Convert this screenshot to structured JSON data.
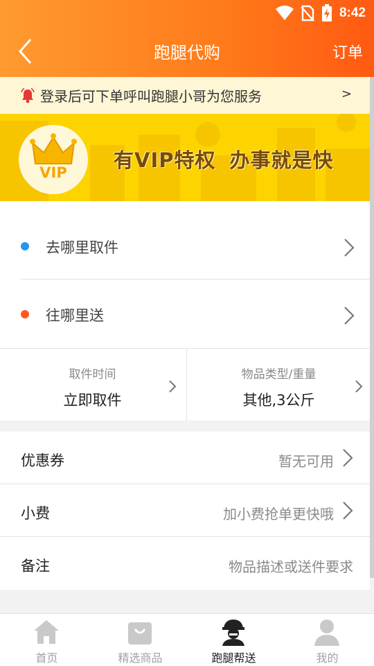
{
  "status_bar": {
    "time": "8:42",
    "icons": [
      "wifi-icon",
      "no-sim-icon",
      "battery-charging-icon"
    ]
  },
  "header": {
    "back_icon": "back-chevron-icon",
    "title": "跑腿代购",
    "orders_label": "订单"
  },
  "notice": {
    "icon": "bell-icon",
    "text": "登录后可下单呼叫跑腿小哥为您服务",
    "arrow": ">"
  },
  "banner": {
    "badge_icon": "crown-icon",
    "badge_text": "VIP",
    "slogan_1": "有VIP特权",
    "slogan_2": "办事就是快"
  },
  "address": {
    "pickup": {
      "label": "去哪里取件",
      "dot_color": "#2196f3"
    },
    "delivery": {
      "label": "往哪里送",
      "dot_color": "#ff5722"
    }
  },
  "options": {
    "pickup_time": {
      "caption": "取件时间",
      "value": "立即取件"
    },
    "item_type": {
      "caption": "物品类型/重量",
      "value": "其他,3公斤"
    }
  },
  "fields": {
    "coupon": {
      "label": "优惠券",
      "value": "暂无可用"
    },
    "tip": {
      "label": "小费",
      "value": "加小费抢单更快哦"
    },
    "note": {
      "label": "备注",
      "placeholder": "物品描述或送件要求"
    }
  },
  "tabbar": {
    "tabs": [
      {
        "label": "首页",
        "icon": "home-icon",
        "active": false
      },
      {
        "label": "精选商品",
        "icon": "shopping-bag-icon",
        "active": false
      },
      {
        "label": "跑腿帮送",
        "icon": "courier-icon",
        "active": true
      },
      {
        "label": "我的",
        "icon": "person-icon",
        "active": false
      }
    ]
  },
  "colors": {
    "header_start": "#ff9a30",
    "header_end": "#ff5a12",
    "banner": "#fdd400",
    "notice_bg": "#fef6d5"
  }
}
